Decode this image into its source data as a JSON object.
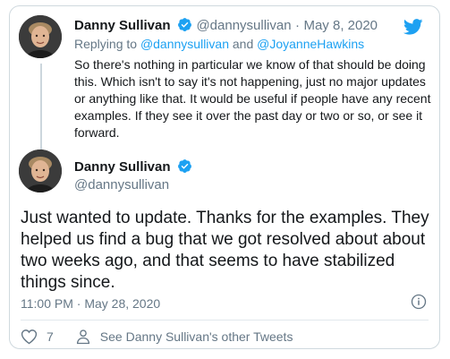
{
  "reply_tweet": {
    "author_name": "Danny Sullivan",
    "author_handle": "@dannysullivan",
    "separator": "·",
    "date": "May 8, 2020",
    "replying_prefix": "Replying to",
    "replying_to_1": "@dannysullivan",
    "replying_and": "and",
    "replying_to_2": "@JoyanneHawkins",
    "text": "So there's nothing in particular we know of that should be doing this. Which isn't to say it's not happening, just no major updates or anything like that. It would be useful if people have any recent examples. If they see it over the past day or two or so, or see it forward."
  },
  "main_tweet": {
    "author_name": "Danny Sullivan",
    "author_handle": "@dannysullivan",
    "text": "Just wanted to update. Thanks for the examples. They helped us find a bug that we got resolved about about two weeks ago, and that seems to have stabilized things since.",
    "timestamp": "11:00 PM · May 28, 2020"
  },
  "actions": {
    "like_count": "7",
    "other_tweets_label": "See Danny Sullivan's other Tweets"
  },
  "colors": {
    "twitter_blue": "#1da1f2",
    "muted": "#657786",
    "text": "#14171a"
  },
  "icons": {
    "logo": "twitter-bird-icon",
    "verified": "verified-badge-icon",
    "info": "info-icon",
    "like": "heart-icon",
    "profile": "person-icon"
  }
}
